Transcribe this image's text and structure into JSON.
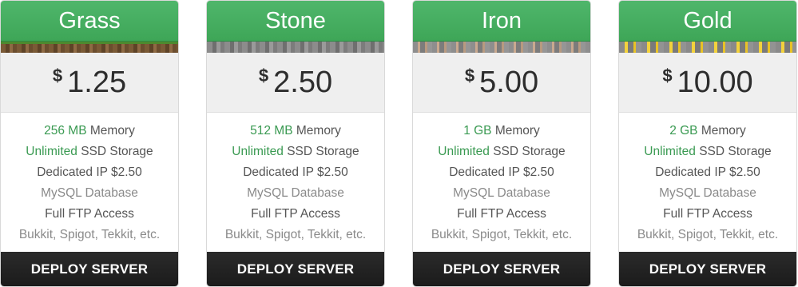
{
  "plans": [
    {
      "name": "Grass",
      "texture": "grass",
      "currency": "$",
      "price": "1.25",
      "memory_value": "256 MB",
      "memory_label": " Memory",
      "storage_value": "Unlimited",
      "storage_label": " SSD Storage",
      "ip": "Dedicated IP $2.50",
      "mysql": "MySQL Database",
      "ftp": "Full FTP Access",
      "mods": "Bukkit, Spigot, Tekkit, etc.",
      "button": "DEPLOY SERVER"
    },
    {
      "name": "Stone",
      "texture": "stone",
      "currency": "$",
      "price": "2.50",
      "memory_value": "512 MB",
      "memory_label": " Memory",
      "storage_value": "Unlimited",
      "storage_label": " SSD Storage",
      "ip": "Dedicated IP $2.50",
      "mysql": "MySQL Database",
      "ftp": "Full FTP Access",
      "mods": "Bukkit, Spigot, Tekkit, etc.",
      "button": "DEPLOY SERVER"
    },
    {
      "name": "Iron",
      "texture": "iron",
      "currency": "$",
      "price": "5.00",
      "memory_value": "1 GB",
      "memory_label": " Memory",
      "storage_value": "Unlimited",
      "storage_label": " SSD Storage",
      "ip": "Dedicated IP $2.50",
      "mysql": "MySQL Database",
      "ftp": "Full FTP Access",
      "mods": "Bukkit, Spigot, Tekkit, etc.",
      "button": "DEPLOY SERVER"
    },
    {
      "name": "Gold",
      "texture": "gold",
      "currency": "$",
      "price": "10.00",
      "memory_value": "2 GB",
      "memory_label": " Memory",
      "storage_value": "Unlimited",
      "storage_label": " SSD Storage",
      "ip": "Dedicated IP $2.50",
      "mysql": "MySQL Database",
      "ftp": "Full FTP Access",
      "mods": "Bukkit, Spigot, Tekkit, etc.",
      "button": "DEPLOY SERVER"
    }
  ],
  "colors": {
    "header_green": "#45ae61",
    "highlight_green": "#3a9a52",
    "button_dark": "#222222",
    "price_bg": "#efefef"
  }
}
